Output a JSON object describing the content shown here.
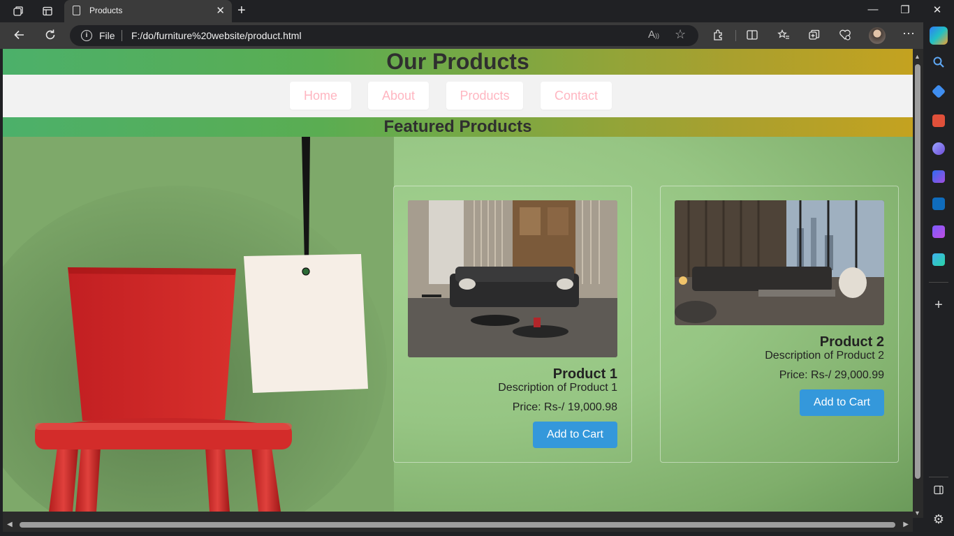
{
  "browser": {
    "tab_title": "Products",
    "site_info_label": "File",
    "url": "F:/do/furniture%20website/product.html"
  },
  "page": {
    "heading": "Our Products",
    "nav": [
      "Home",
      "About",
      "Products",
      "Contact"
    ],
    "section_title": "Featured Products",
    "products": [
      {
        "name": "Product 1",
        "description": "Description of Product 1",
        "price": "Price: Rs-/ 19,000.98",
        "button": "Add to Cart"
      },
      {
        "name": "Product 2",
        "description": "Description of Product 2",
        "price": "Price: Rs-/ 29,000.99",
        "button": "Add to Cart"
      }
    ]
  },
  "colors": {
    "nav_text": "#ffb6c1",
    "button": "#3498db",
    "chair_red": "#d42a2a"
  }
}
